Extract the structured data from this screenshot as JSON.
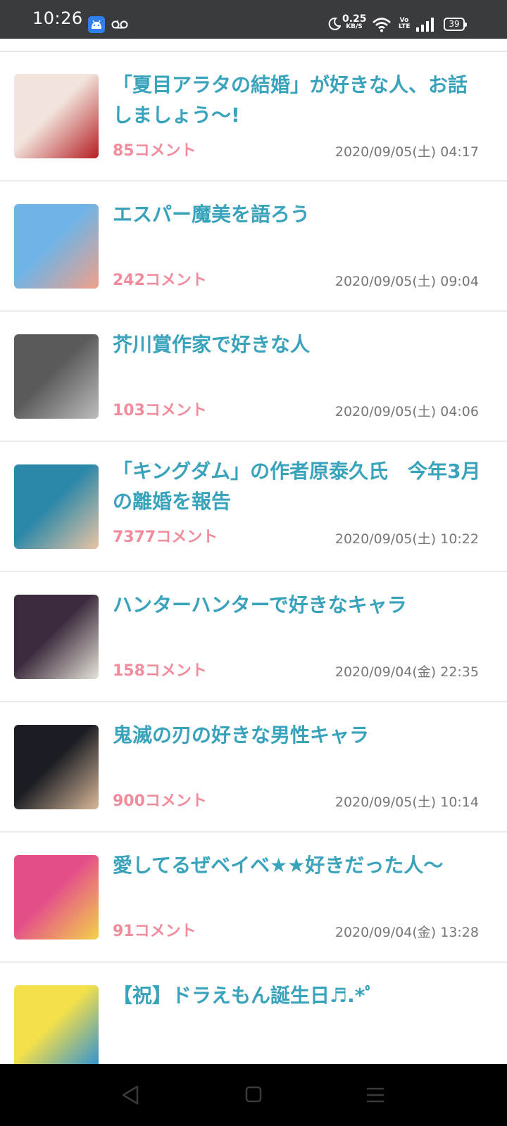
{
  "status_bar": {
    "time": "10:26",
    "net_speed_value": "0.25",
    "net_speed_unit": "KB/S",
    "volte_top": "Vo",
    "volte_bottom": "LTE",
    "battery": "39"
  },
  "items": [
    {
      "title": "「夏目アラタの結婚」が好きな人、お話しましょう〜!",
      "comments": "85コメント",
      "date": "2020/09/05(土) 04:17",
      "thumb_colors": [
        "#f2e4dc",
        "#b51d22"
      ]
    },
    {
      "title": "エスパー魔美を語ろう",
      "comments": "242コメント",
      "date": "2020/09/05(土) 09:04",
      "thumb_colors": [
        "#6fb4e6",
        "#f0a08a"
      ]
    },
    {
      "title": "芥川賞作家で好きな人",
      "comments": "103コメント",
      "date": "2020/09/05(土) 04:06",
      "thumb_colors": [
        "#5a5a5a",
        "#bdbdbd"
      ]
    },
    {
      "title": "「キングダム」の作者原泰久氏　今年3月の離婚を報告",
      "comments": "7377コメント",
      "date": "2020/09/05(土) 10:22",
      "thumb_colors": [
        "#2b88a8",
        "#e9c4a4"
      ]
    },
    {
      "title": "ハンターハンターで好きなキャラ",
      "comments": "158コメント",
      "date": "2020/09/04(金) 22:35",
      "thumb_colors": [
        "#3b2a3d",
        "#e6e4d8"
      ]
    },
    {
      "title": "鬼滅の刃の好きな男性キャラ",
      "comments": "900コメント",
      "date": "2020/09/05(土) 10:14",
      "thumb_colors": [
        "#1b1d24",
        "#d9b99a"
      ]
    },
    {
      "title": "愛してるぜベイベ★★好きだった人〜",
      "comments": "91コメント",
      "date": "2020/09/04(金) 13:28",
      "thumb_colors": [
        "#e44f8a",
        "#f3d24a"
      ]
    },
    {
      "title": "【祝】ドラえもん誕生日♬.*ﾟ",
      "comments": "",
      "date": "",
      "thumb_colors": [
        "#f3e04a",
        "#2a8fd8"
      ]
    }
  ]
}
